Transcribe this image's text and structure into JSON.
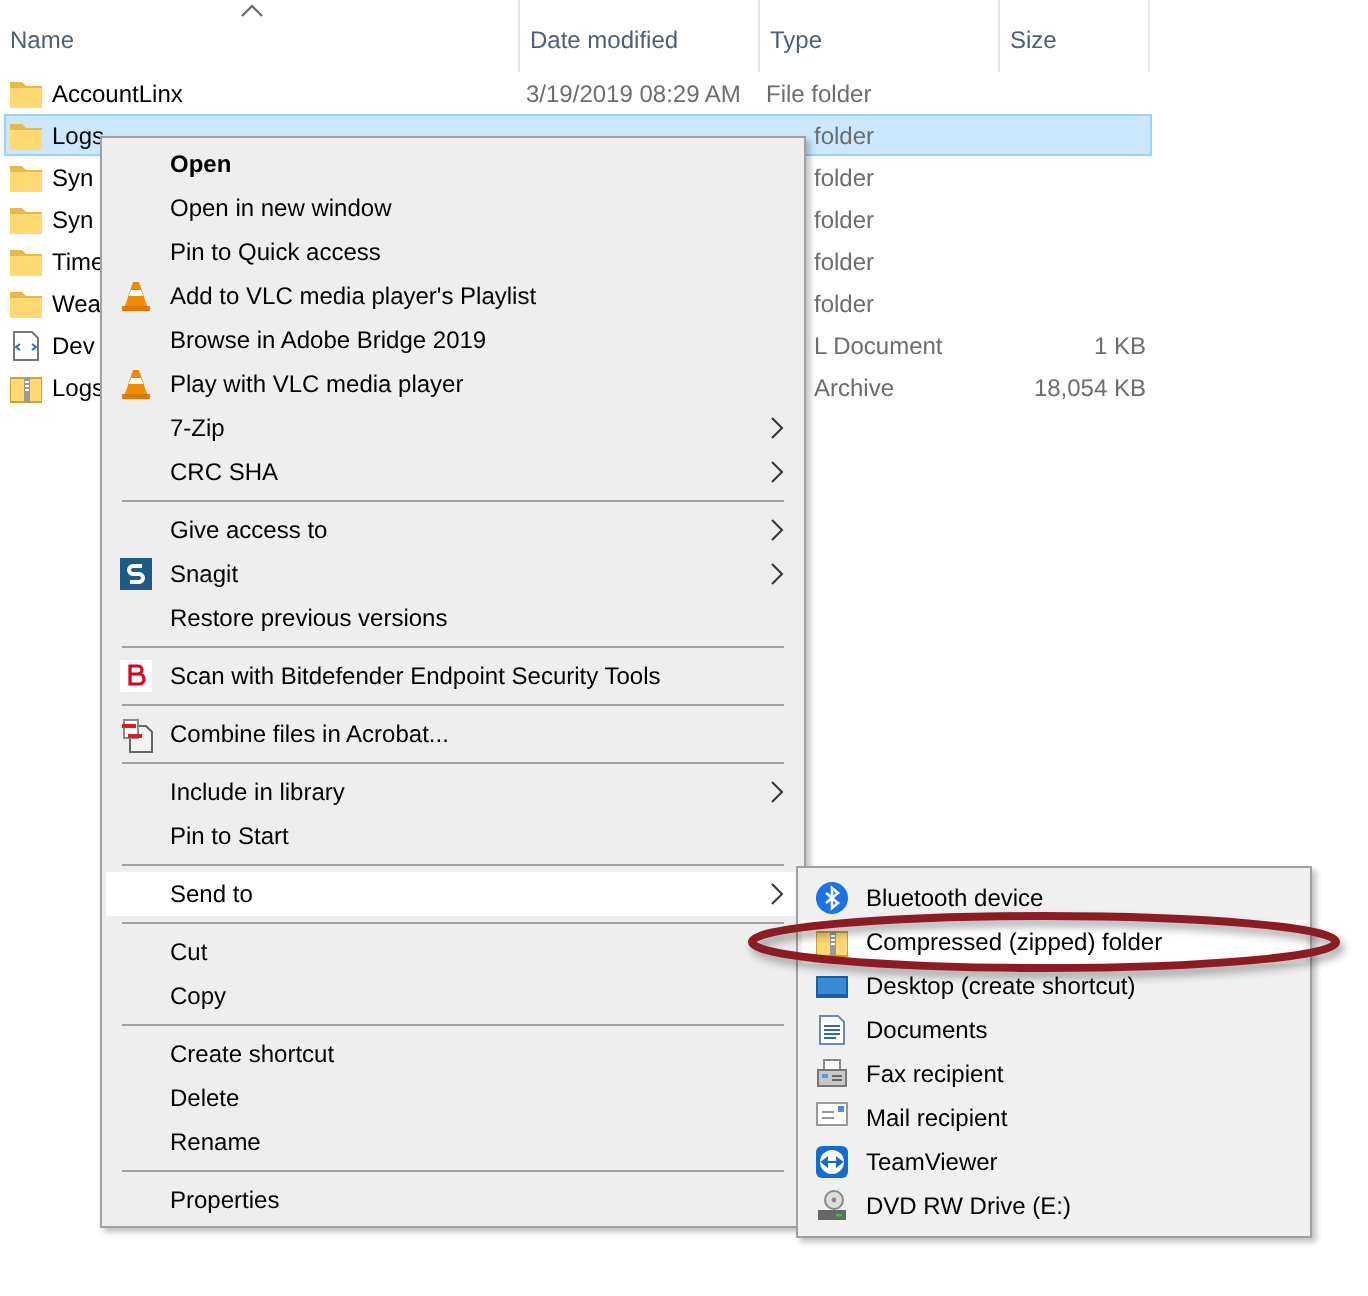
{
  "columns": [
    {
      "label": "Name",
      "sorted": true
    },
    {
      "label": "Date modified",
      "sorted": false
    },
    {
      "label": "Type",
      "sorted": false
    },
    {
      "label": "Size",
      "sorted": false
    }
  ],
  "files": [
    {
      "kind": "folder",
      "name": "AccountLinx",
      "date": "3/19/2019 08:29 AM",
      "type": "File folder",
      "selected": false
    },
    {
      "kind": "folder",
      "name": "Logs",
      "type": "folder",
      "selected": true
    },
    {
      "kind": "folder",
      "name": "Syn",
      "type": "folder",
      "selected": false
    },
    {
      "kind": "folder",
      "name": "Syn",
      "type": "folder",
      "selected": false
    },
    {
      "kind": "folder",
      "name": "Time",
      "type": "folder",
      "selected": false
    },
    {
      "kind": "folder",
      "name": "Wea",
      "type": "folder",
      "selected": false
    },
    {
      "kind": "document",
      "name": "Dev",
      "type": "L Document",
      "size": "1 KB",
      "selected": false
    },
    {
      "kind": "archive",
      "name": "Logs",
      "type": "Archive",
      "size": "18,054 KB",
      "selected": false
    }
  ],
  "context_menu": [
    {
      "kind": "item",
      "label": "Open",
      "bold": true,
      "submenu": false,
      "selected": false
    },
    {
      "kind": "item",
      "label": "Open in new window",
      "submenu": false,
      "selected": false
    },
    {
      "kind": "item",
      "label": "Pin to Quick access",
      "submenu": false,
      "selected": false
    },
    {
      "kind": "item",
      "label": "Add to VLC media player's Playlist",
      "submenu": false,
      "selected": false
    },
    {
      "kind": "item",
      "label": "Browse in Adobe Bridge 2019",
      "submenu": false,
      "selected": false
    },
    {
      "kind": "item",
      "label": "Play with VLC media player",
      "submenu": false,
      "selected": false
    },
    {
      "kind": "item",
      "label": "7-Zip",
      "submenu": true,
      "selected": false
    },
    {
      "kind": "item",
      "label": "CRC SHA",
      "submenu": true,
      "selected": false
    },
    {
      "kind": "separator"
    },
    {
      "kind": "item",
      "label": "Give access to",
      "submenu": true,
      "selected": false
    },
    {
      "kind": "item",
      "label": "Snagit",
      "submenu": true,
      "selected": false
    },
    {
      "kind": "item",
      "label": "Restore previous versions",
      "submenu": false,
      "selected": false
    },
    {
      "kind": "separator"
    },
    {
      "kind": "item",
      "label": "Scan with Bitdefender Endpoint Security Tools",
      "submenu": false,
      "selected": false
    },
    {
      "kind": "separator"
    },
    {
      "kind": "item",
      "label": "Combine files in Acrobat...",
      "submenu": false,
      "selected": false
    },
    {
      "kind": "separator"
    },
    {
      "kind": "item",
      "label": "Include in library",
      "submenu": true,
      "selected": false
    },
    {
      "kind": "item",
      "label": "Pin to Start",
      "submenu": false,
      "selected": false
    },
    {
      "kind": "separator"
    },
    {
      "kind": "item",
      "label": "Send to",
      "submenu": true,
      "selected": true
    },
    {
      "kind": "separator"
    },
    {
      "kind": "item",
      "label": "Cut",
      "submenu": false,
      "selected": false
    },
    {
      "kind": "item",
      "label": "Copy",
      "submenu": false,
      "selected": false
    },
    {
      "kind": "separator"
    },
    {
      "kind": "item",
      "label": "Create shortcut",
      "submenu": false,
      "selected": false
    },
    {
      "kind": "item",
      "label": "Delete",
      "submenu": false,
      "selected": false
    },
    {
      "kind": "item",
      "label": "Rename",
      "submenu": false,
      "selected": false
    },
    {
      "kind": "separator"
    },
    {
      "kind": "item",
      "label": "Properties",
      "submenu": false,
      "selected": false
    }
  ],
  "send_to_menu": [
    {
      "label": "Bluetooth device",
      "selected": false
    },
    {
      "label": "Compressed (zipped) folder",
      "selected": true
    },
    {
      "label": "Desktop (create shortcut)",
      "selected": false
    },
    {
      "label": "Documents",
      "selected": false
    },
    {
      "label": "Fax recipient",
      "selected": false
    },
    {
      "label": "Mail recipient",
      "selected": false
    },
    {
      "label": "TeamViewer",
      "selected": false
    },
    {
      "label": "DVD RW Drive (E:)",
      "selected": false
    }
  ]
}
